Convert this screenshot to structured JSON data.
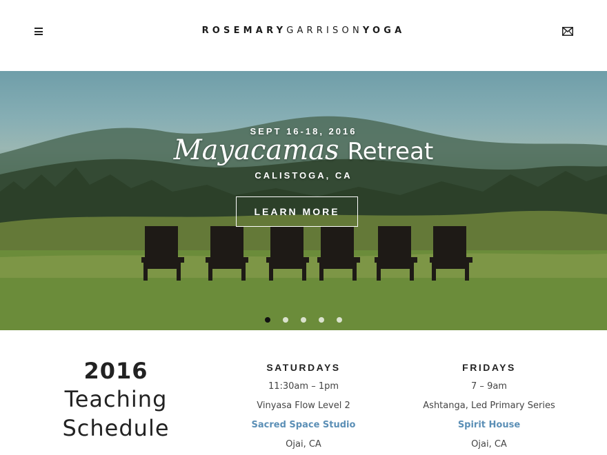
{
  "header": {
    "logo": {
      "part1": "ROSEMARY",
      "part2": "GARRISON",
      "part3": "YOGA"
    },
    "menu_icon": "hamburger-menu-icon",
    "mail_icon": "envelope-icon"
  },
  "hero": {
    "date": "SEPT 16-18, 2016",
    "title_script": "Mayacamas",
    "title_plain": "Retreat",
    "location": "CALISTOGA, CA",
    "button_label": "LEARN MORE",
    "slides_total": 5,
    "slide_active": 1
  },
  "schedule": {
    "year": "2016",
    "title_line1": "Teaching",
    "title_line2": "Schedule",
    "columns": [
      {
        "day": "SATURDAYS",
        "time": "11:30am – 1pm",
        "class": "Vinyasa Flow Level 2",
        "studio": "Sacred Space Studio",
        "city": "Ojai, CA"
      },
      {
        "day": "FRIDAYS",
        "time": "7 – 9am",
        "class": "Ashtanga, Led Primary Series",
        "studio": "Spirit House",
        "city": "Ojai, CA"
      }
    ]
  },
  "colors": {
    "studio_link": "#5b8fb6",
    "active_dot": "#111111",
    "text": "#222222"
  }
}
